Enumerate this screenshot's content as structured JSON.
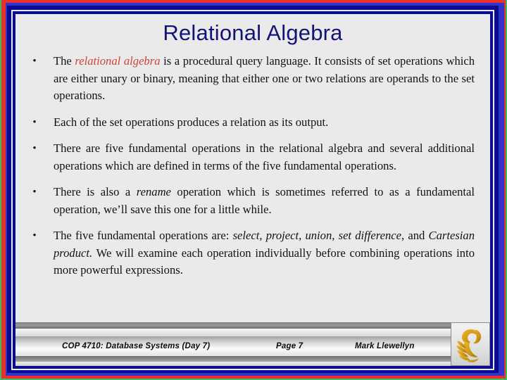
{
  "slide": {
    "title": "Relational Algebra",
    "bullet_marker": "•",
    "colors": {
      "frame_green": "#3fba6a",
      "frame_red": "#e8332a",
      "frame_violet": "#3333cc",
      "frame_navy": "#0b0b8f",
      "canvas": "#eaeaea",
      "title_text": "#141478",
      "body_text": "#121212",
      "emphasis_red": "#cf4338",
      "logo_gold": "#d8a019"
    }
  },
  "bullets": [
    {
      "id": "bullet-1",
      "runs": [
        {
          "text": "The ",
          "style": "normal"
        },
        {
          "text": "relational algebra",
          "style": "italic-red"
        },
        {
          "text": " is a procedural query language.  It consists of set operations which are either unary or binary, meaning that either one or two relations are operands to the set operations.",
          "style": "normal"
        }
      ]
    },
    {
      "id": "bullet-2",
      "runs": [
        {
          "text": "Each of the set operations produces a relation as its output.",
          "style": "normal"
        }
      ]
    },
    {
      "id": "bullet-3",
      "runs": [
        {
          "text": "There are five fundamental operations in the relational algebra and several additional operations which are defined in terms of the five fundamental operations.",
          "style": "normal"
        }
      ]
    },
    {
      "id": "bullet-4",
      "runs": [
        {
          "text": "There is also a ",
          "style": "normal"
        },
        {
          "text": "rename",
          "style": "italic"
        },
        {
          "text": " operation which is sometimes referred to as a fundamental operation, we’ll save this one for a little while.",
          "style": "normal"
        }
      ]
    },
    {
      "id": "bullet-5",
      "runs": [
        {
          "text": "The five fundamental operations are: ",
          "style": "normal"
        },
        {
          "text": "select, project, union, set difference,",
          "style": "italic"
        },
        {
          "text": " and ",
          "style": "normal"
        },
        {
          "text": "Cartesian product.",
          "style": "italic"
        },
        {
          "text": "  We will examine each operation individually before combining operations into more powerful expressions.",
          "style": "normal"
        }
      ]
    }
  ],
  "footer": {
    "course": "COP 4710: Database Systems  (Day 7)",
    "page": "Page 7",
    "author": "Mark Llewellyn",
    "logo_name": "ucf-pegasus-logo"
  }
}
